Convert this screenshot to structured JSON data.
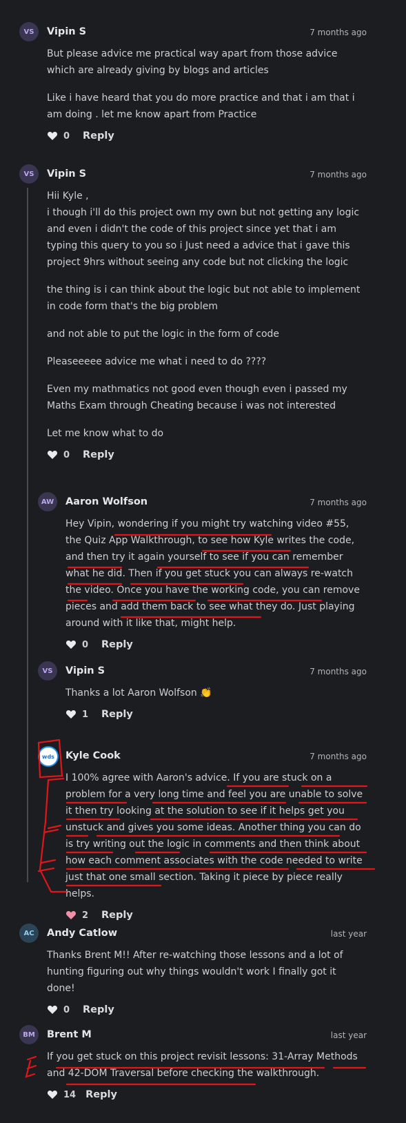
{
  "comments": [
    {
      "author": "Vipin S",
      "initials": "VS",
      "time": "7 months ago",
      "paragraphs": [
        "But please advice me practical way apart from those advice which are already giving by blogs and articles",
        "Like i have heard that you do more practice and that i am that i am doing . let me know apart from Practice"
      ],
      "likes": "0",
      "reply": "Reply"
    },
    {
      "author": "Vipin S",
      "initials": "VS",
      "time": "7 months ago",
      "paragraphs": [
        "Hii Kyle ,\ni though i'll do this project own my own but not getting any logic and even i didn't the code of this project since yet that i am typing this query to you so i Just need a advice that i gave this project 9hrs without seeing any code but not clicking the logic",
        "the thing is i can think about the logic but not able to implement in code form that's the big problem",
        "and not able to put the logic in the form of code",
        "Pleaseeeee advice me what i need to do ????",
        "Even my mathmatics not good even though even i passed my Maths Exam through Cheating because i was not interested",
        "Let me know what to do"
      ],
      "likes": "0",
      "reply": "Reply"
    },
    {
      "author": "Aaron Wolfson",
      "initials": "AW",
      "time": "7 months ago",
      "paragraphs": [
        "Hey Vipin, wondering if you might try watching video #55, the Quiz App Walkthrough, to see how Kyle writes the code, and then try it again yourself to see if you can remember what he did. Then if you get stuck you can always re-watch the video. Once you have the working code, you can remove pieces and add them back to see what they do. Just playing around with it like that, might help."
      ],
      "likes": "0",
      "reply": "Reply"
    },
    {
      "author": "Vipin S",
      "initials": "VS",
      "time": "7 months ago",
      "paragraphs": [
        "Thanks a lot Aaron Wolfson 👏"
      ],
      "likes": "1",
      "reply": "Reply"
    },
    {
      "author": "Kyle Cook",
      "initials": "wds",
      "time": "7 months ago",
      "paragraphs": [
        "I 100% agree with Aaron's advice. If you are stuck on a problem for a very long time and feel you are unable to solve it then try looking at the solution to see if it helps get you unstuck and gives you some ideas. Another thing you can do is try writing out the logic in comments and then think about how each comment associates with the code needed to write just that one small section. Taking it piece by piece really helps."
      ],
      "likes": "2",
      "reply": "Reply"
    },
    {
      "author": "Andy Catlow",
      "initials": "AC",
      "time": "last year",
      "paragraphs": [
        "Thanks Brent M!! After re-watching those lessons and a lot of hunting figuring out why things wouldn't work I finally got it done!"
      ],
      "likes": "0",
      "reply": "Reply"
    },
    {
      "author": "Brent M",
      "initials": "BM",
      "time": "last year",
      "paragraphs": [
        "If you get stuck on this project revisit lessons: 31-Array Methods and 42-DOM Traversal before checking the walkthrough."
      ],
      "likes": "14",
      "reply": "Reply"
    }
  ],
  "colors": {
    "background": "#1c1d20",
    "liked_heart": "#f08fa8",
    "annotation": "#e0161b"
  }
}
